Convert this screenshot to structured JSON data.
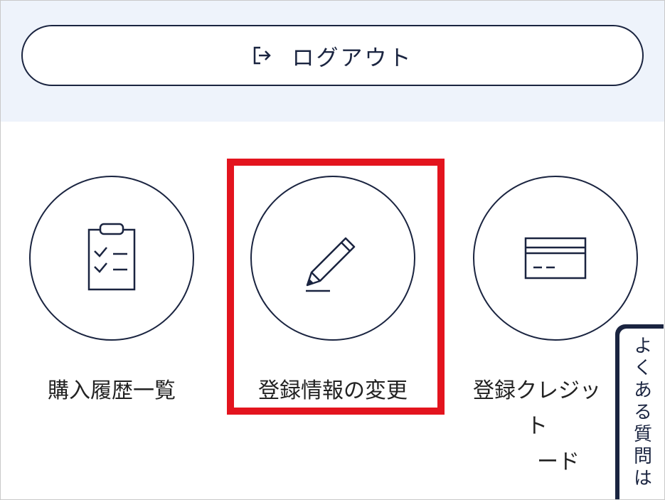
{
  "colors": {
    "navy": "#1a2440",
    "highlight": "#e3141e",
    "top_band": "#eef3fb"
  },
  "logout": {
    "label": "ログアウト",
    "icon": "logout-icon"
  },
  "menu": [
    {
      "label": "購入履歴一覧",
      "icon": "clipboard-checklist-icon"
    },
    {
      "label": "登録情報の変更",
      "icon": "pencil-icon"
    },
    {
      "label": "登録クレジットカード",
      "label_line1": "登録クレジット",
      "label_line2": "ード",
      "icon": "credit-card-icon"
    }
  ],
  "faq_tab": {
    "label": "よくある質問は"
  }
}
